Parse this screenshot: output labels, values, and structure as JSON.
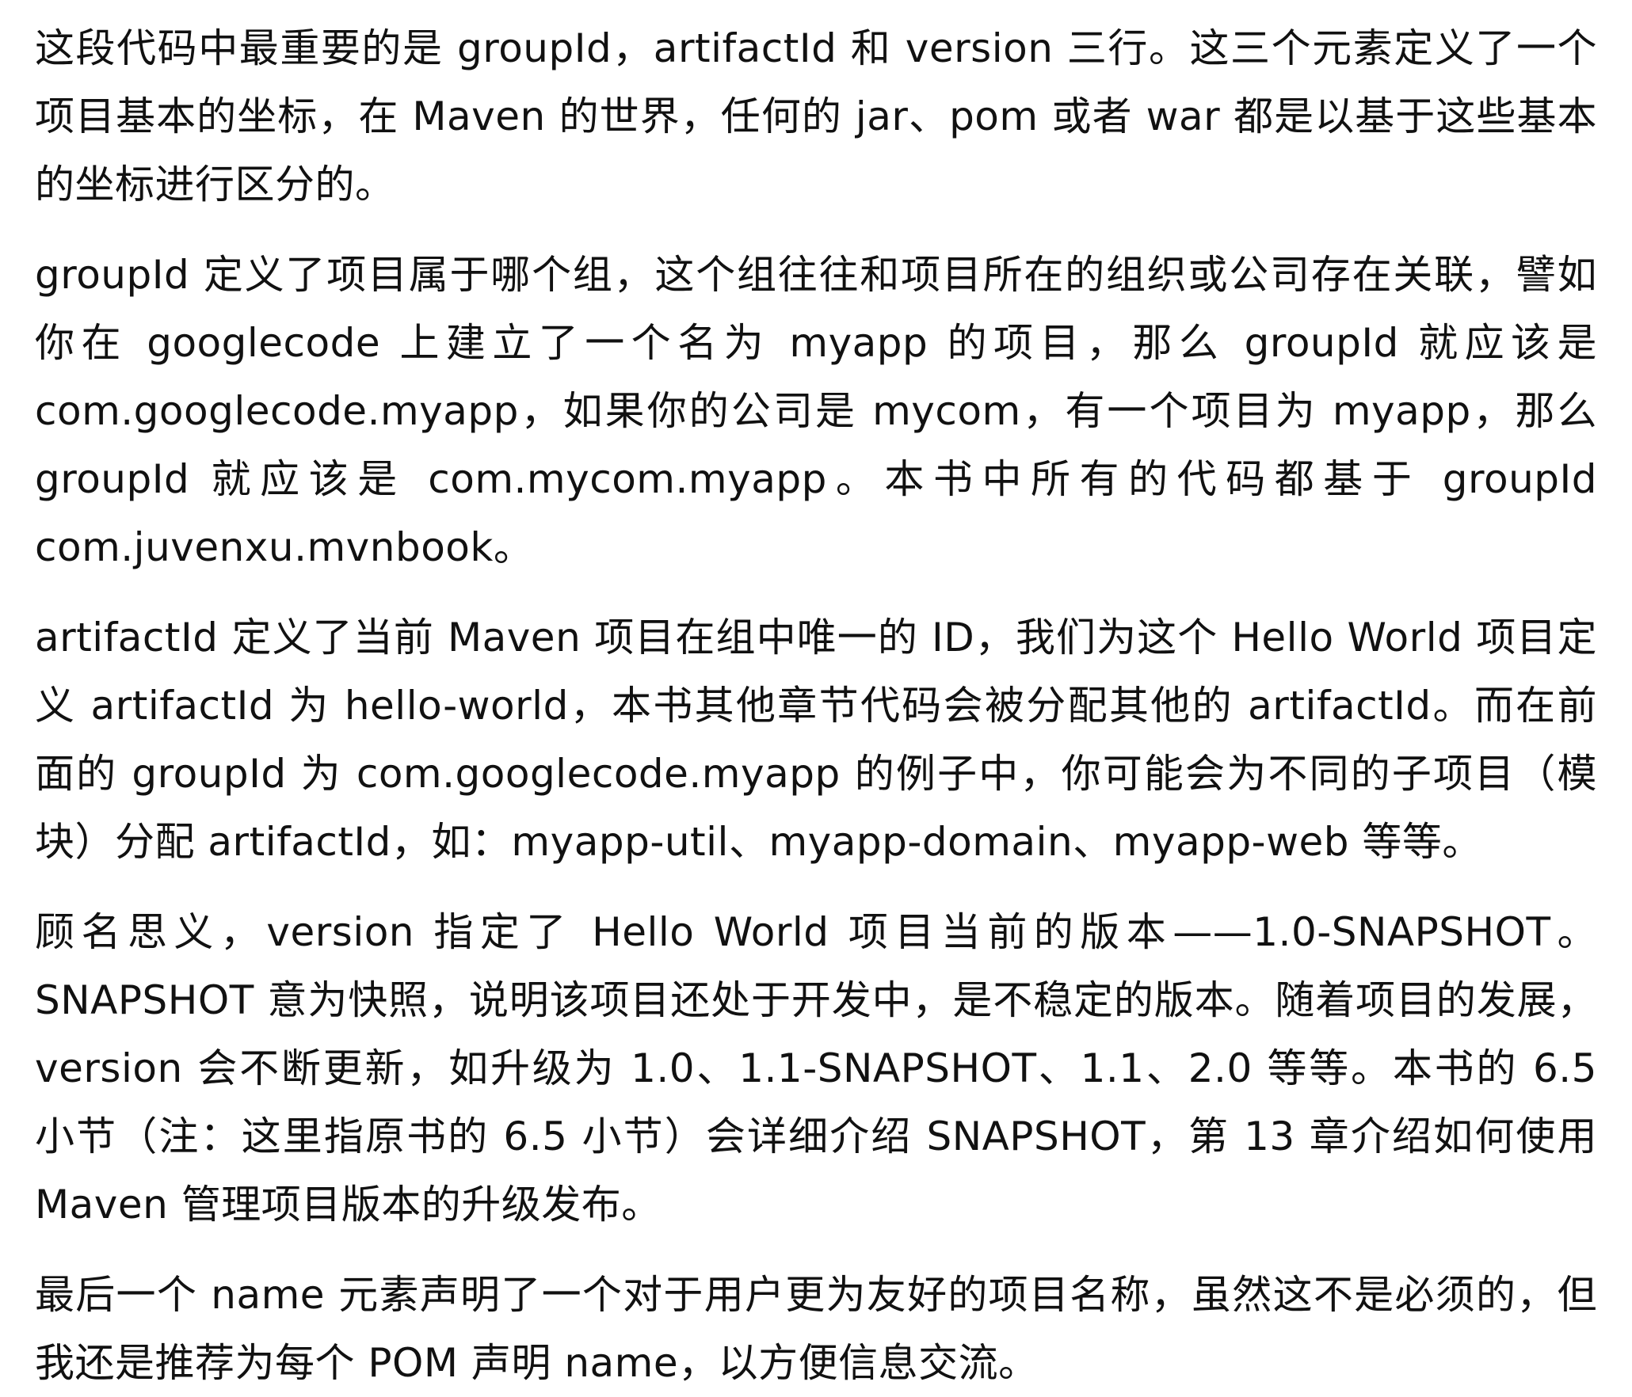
{
  "document": {
    "paragraphs": [
      "这段代码中最重要的是 groupId，artifactId 和 version 三行。这三个元素定义了一个项目基本的坐标，在 Maven 的世界，任何的 jar、pom 或者 war 都是以基于这些基本的坐标进行区分的。",
      "groupId 定义了项目属于哪个组，这个组往往和项目所在的组织或公司存在关联，譬如你在 googlecode 上建立了一个名为 myapp 的项目，那么 groupId 就应该是 com.googlecode.myapp，如果你的公司是 mycom，有一个项目为 myapp，那么 groupId 就应该是 com.mycom.myapp。本书中所有的代码都基于 groupId com.juvenxu.mvnbook。",
      "artifactId 定义了当前 Maven 项目在组中唯一的 ID，我们为这个 Hello World 项目定义 artifactId 为 hello-world，本书其他章节代码会被分配其他的 artifactId。而在前面的 groupId 为 com.googlecode.myapp 的例子中，你可能会为不同的子项目（模块）分配 artifactId，如：myapp-util、myapp-domain、myapp-web 等等。",
      "顾名思义，version 指定了 Hello World 项目当前的版本——1.0-SNAPSHOT。SNAPSHOT 意为快照，说明该项目还处于开发中，是不稳定的版本。随着项目的发展，version 会不断更新，如升级为 1.0、1.1-SNAPSHOT、1.1、2.0 等等。本书的 6.5 小节（注：这里指原书的 6.5 小节）会详细介绍 SNAPSHOT，第 13 章介绍如何使用 Maven 管理项目版本的升级发布。",
      "最后一个 name 元素声明了一个对于用户更为友好的项目名称，虽然这不是必须的，但我还是推荐为每个 POM 声明 name，以方便信息交流。"
    ]
  }
}
